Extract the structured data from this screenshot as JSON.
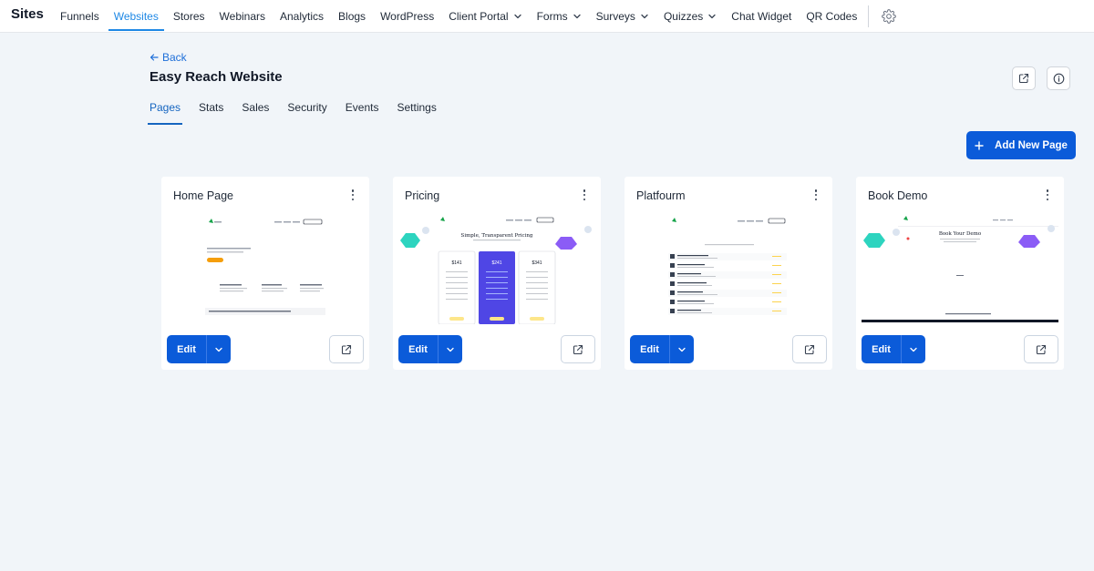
{
  "app": {
    "title": "Sites"
  },
  "nav": {
    "items": [
      {
        "label": "Funnels",
        "active": false,
        "dropdown": false
      },
      {
        "label": "Websites",
        "active": true,
        "dropdown": false
      },
      {
        "label": "Stores",
        "active": false,
        "dropdown": false
      },
      {
        "label": "Webinars",
        "active": false,
        "dropdown": false
      },
      {
        "label": "Analytics",
        "active": false,
        "dropdown": false
      },
      {
        "label": "Blogs",
        "active": false,
        "dropdown": false
      },
      {
        "label": "WordPress",
        "active": false,
        "dropdown": false
      },
      {
        "label": "Client Portal",
        "active": false,
        "dropdown": true
      },
      {
        "label": "Forms",
        "active": false,
        "dropdown": true
      },
      {
        "label": "Surveys",
        "active": false,
        "dropdown": true
      },
      {
        "label": "Quizzes",
        "active": false,
        "dropdown": true
      },
      {
        "label": "Chat Widget",
        "active": false,
        "dropdown": false
      },
      {
        "label": "QR Codes",
        "active": false,
        "dropdown": false
      }
    ],
    "settings_icon": "gear-icon"
  },
  "header": {
    "back_label": "Back",
    "title": "Easy Reach Website",
    "external_icon": "external-link-icon",
    "info_icon": "info-icon"
  },
  "tabs": [
    {
      "label": "Pages",
      "active": true
    },
    {
      "label": "Stats",
      "active": false
    },
    {
      "label": "Sales",
      "active": false
    },
    {
      "label": "Security",
      "active": false
    },
    {
      "label": "Events",
      "active": false
    },
    {
      "label": "Settings",
      "active": false
    }
  ],
  "actions": {
    "add_page_label": "Add New Page"
  },
  "cards": [
    {
      "title": "Home Page",
      "edit_label": "Edit"
    },
    {
      "title": "Pricing",
      "edit_label": "Edit"
    },
    {
      "title": "Platfourm",
      "edit_label": "Edit"
    },
    {
      "title": "Book Demo",
      "edit_label": "Edit"
    }
  ],
  "thumbnails": {
    "pricing": {
      "heading": "Simple, Transparent Pricing",
      "prices": [
        "$141",
        "$241",
        "$341"
      ]
    },
    "book_demo": {
      "heading": "Book Your Demo"
    }
  },
  "colors": {
    "primary": "#0b5bd9",
    "nav_active": "#1e88e5",
    "background": "#f1f5f9"
  }
}
